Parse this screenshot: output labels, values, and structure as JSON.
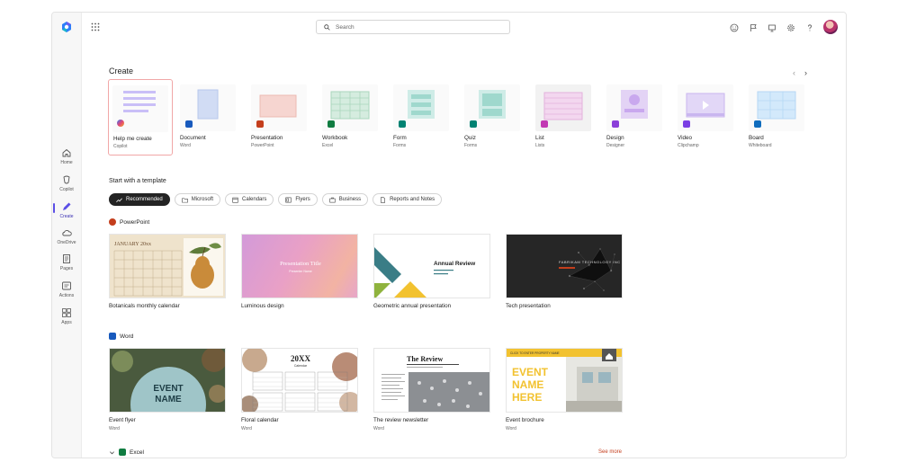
{
  "search": {
    "placeholder": "Search"
  },
  "rail": [
    {
      "label": "Home",
      "icon": "home-icon"
    },
    {
      "label": "Copilot",
      "icon": "copilot-icon"
    },
    {
      "label": "Create",
      "icon": "create-pen-icon",
      "active": true
    },
    {
      "label": "OneDrive",
      "icon": "cloud-icon"
    },
    {
      "label": "Pages",
      "icon": "pages-icon"
    },
    {
      "label": "Actions",
      "icon": "actions-icon"
    },
    {
      "label": "Apps",
      "icon": "apps-icon"
    }
  ],
  "create": {
    "title": "Create",
    "tiles": [
      {
        "name": "Help me create",
        "sub": "Copilot",
        "color": "#7b6cf0"
      },
      {
        "name": "Document",
        "sub": "Word",
        "color": "#185abd"
      },
      {
        "name": "Presentation",
        "sub": "PowerPoint",
        "color": "#c43e1c"
      },
      {
        "name": "Workbook",
        "sub": "Excel",
        "color": "#107c41"
      },
      {
        "name": "Form",
        "sub": "Forms",
        "color": "#008272"
      },
      {
        "name": "Quiz",
        "sub": "Forms",
        "color": "#008272"
      },
      {
        "name": "List",
        "sub": "Lists",
        "color": "#c239b3"
      },
      {
        "name": "Design",
        "sub": "Designer",
        "color": "#8b3fd9"
      },
      {
        "name": "Video",
        "sub": "Clipchamp",
        "color": "#7b3fe4"
      },
      {
        "name": "Board",
        "sub": "Whiteboard",
        "color": "#0f6cbd"
      }
    ]
  },
  "templates": {
    "title": "Start with a template",
    "filters": [
      "Recommended",
      "Microsoft",
      "Calendars",
      "Flyers",
      "Business",
      "Reports and Notes"
    ],
    "groups": [
      {
        "name": "PowerPoint",
        "color": "#c43e1c",
        "cards": [
          {
            "name": "Botanicals monthly calendar",
            "sub": ""
          },
          {
            "name": "Luminous design",
            "sub": ""
          },
          {
            "name": "Geometric annual presentation",
            "sub": ""
          },
          {
            "name": "Tech presentation",
            "sub": ""
          }
        ]
      },
      {
        "name": "Word",
        "color": "#185abd",
        "cards": [
          {
            "name": "Event flyer",
            "sub": "Word"
          },
          {
            "name": "Floral calendar",
            "sub": "Word"
          },
          {
            "name": "The review newsletter",
            "sub": "Word"
          },
          {
            "name": "Event brochure",
            "sub": "Word"
          }
        ]
      }
    ],
    "excel_group": "Excel",
    "see_more": "See more"
  },
  "thumbs": {
    "cal_month": "JANUARY 20xx",
    "lum_title": "Presentation Title",
    "lum_sub": "Presenter Name",
    "annual": "Annual Review",
    "tech": "FABRIKAM TECHNOLOGY INC",
    "event1": "EVENT",
    "event2": "NAME",
    "floral_year": "20XX",
    "floral_cal": "Calendar",
    "review": "The Review",
    "brochure_banner": "CLICK TO ENTER PROPERTY NAME",
    "brochure_l1": "EVENT",
    "brochure_l2": "NAME",
    "brochure_l3": "HERE"
  }
}
